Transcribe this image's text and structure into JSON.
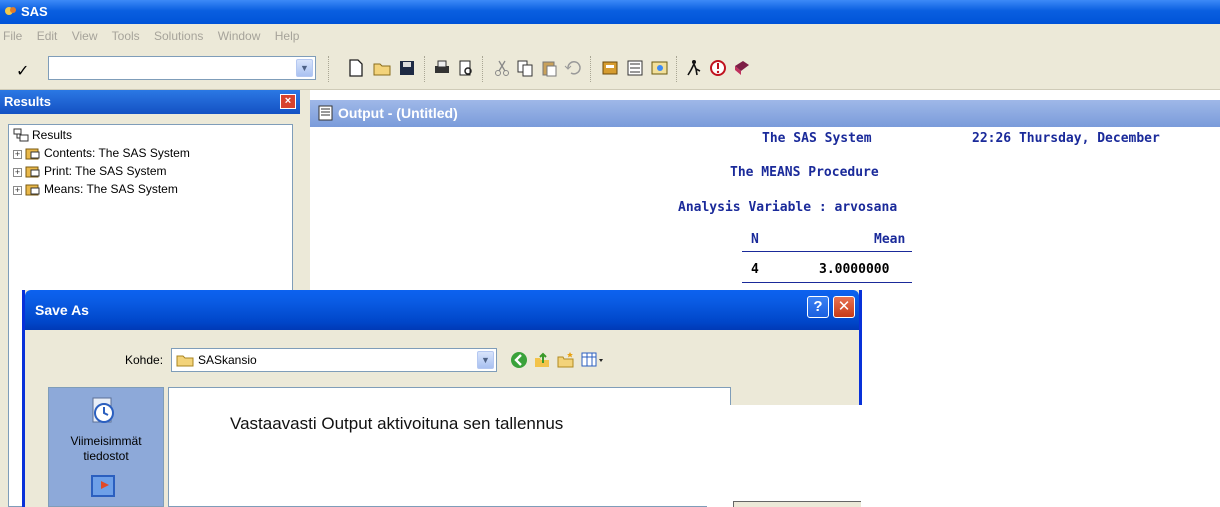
{
  "app": {
    "title": "SAS"
  },
  "menu": [
    "File",
    "Edit",
    "View",
    "Tools",
    "Solutions",
    "Window",
    "Help"
  ],
  "toolbar": {
    "command_check": "✓",
    "command_value": "",
    "icons": [
      "new-icon",
      "open-icon",
      "save-icon",
      "print-icon",
      "print-preview-icon",
      "cut-icon",
      "copy-icon",
      "paste-icon",
      "undo-icon",
      "libraries-icon",
      "explorer-icon",
      "find-icon",
      "run-icon",
      "submit-icon",
      "help-book-icon"
    ]
  },
  "results": {
    "header": "Results",
    "close_label": "×",
    "tree_root": "Results",
    "items": [
      {
        "label": "Contents: The SAS System"
      },
      {
        "label": "Print: The SAS System"
      },
      {
        "label": "Means: The SAS System"
      }
    ]
  },
  "output": {
    "title": "Output - (Untitled)",
    "system_title": "The SAS System",
    "timestamp": "22:26 Thursday, December",
    "procedure": "The MEANS Procedure",
    "analysis": "Analysis Variable : arvosana",
    "col_n": "N",
    "col_mean": "Mean",
    "val_n": "4",
    "val_mean": "3.0000000"
  },
  "save_dialog": {
    "title": "Save As",
    "help_label": "?",
    "close_label": "✕",
    "location_label": "Kohde:",
    "location_value": "SASkansio",
    "recent_label_line1": "Viimeisimmät",
    "recent_label_line2": "tiedostot"
  },
  "caption": "Vastaavasti Output aktivoituna sen tallennus",
  "colors": {
    "title_blue": "#0a5fe0",
    "output_text": "#1a2a9a",
    "dialog_face": "#ece9d8",
    "close_red": "#d8432d"
  }
}
